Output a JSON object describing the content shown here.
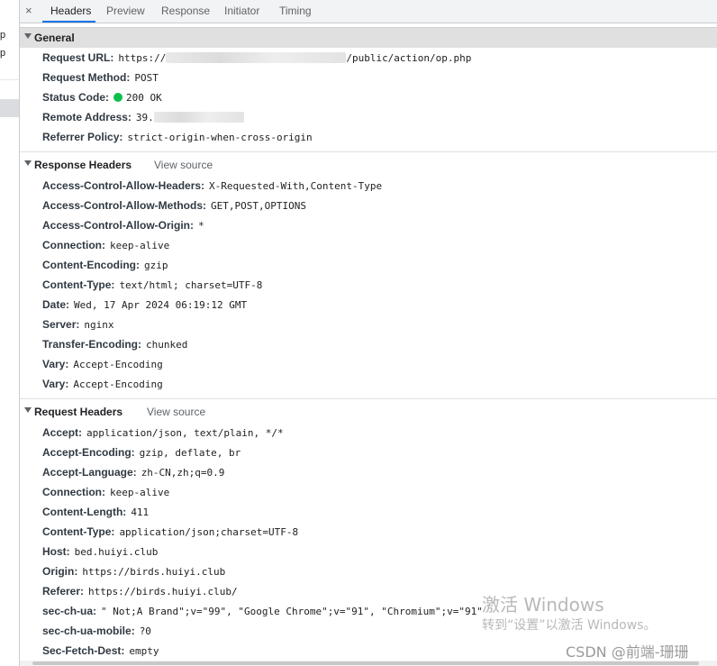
{
  "left_fragments": [
    "p",
    "p"
  ],
  "tabs": [
    {
      "label": "Headers"
    },
    {
      "label": "Preview"
    },
    {
      "label": "Response"
    },
    {
      "label": "Initiator"
    },
    {
      "label": "Timing"
    }
  ],
  "close_glyph": "×",
  "general": {
    "title": "General",
    "request_url_key": "Request URL:",
    "request_url_prefix": "https://",
    "request_url_suffix": "/public/action/op.php",
    "request_method_key": "Request Method:",
    "request_method": "POST",
    "status_code_key": "Status Code:",
    "status_code": "200 OK",
    "status_color": "#0ebe4b",
    "remote_address_key": "Remote Address:",
    "remote_address_prefix": "39.",
    "referrer_policy_key": "Referrer Policy:",
    "referrer_policy": "strict-origin-when-cross-origin"
  },
  "response_headers": {
    "title": "Response Headers",
    "view_source": "View source",
    "rows": [
      {
        "key": "Access-Control-Allow-Headers:",
        "value": "X-Requested-With,Content-Type"
      },
      {
        "key": "Access-Control-Allow-Methods:",
        "value": "GET,POST,OPTIONS"
      },
      {
        "key": "Access-Control-Allow-Origin:",
        "value": "*"
      },
      {
        "key": "Connection:",
        "value": "keep-alive"
      },
      {
        "key": "Content-Encoding:",
        "value": "gzip"
      },
      {
        "key": "Content-Type:",
        "value": "text/html; charset=UTF-8"
      },
      {
        "key": "Date:",
        "value": "Wed, 17 Apr 2024 06:19:12 GMT"
      },
      {
        "key": "Server:",
        "value": "nginx"
      },
      {
        "key": "Transfer-Encoding:",
        "value": "chunked"
      },
      {
        "key": "Vary:",
        "value": "Accept-Encoding"
      },
      {
        "key": "Vary:",
        "value": "Accept-Encoding"
      }
    ]
  },
  "request_headers": {
    "title": "Request Headers",
    "view_source": "View source",
    "rows": [
      {
        "key": "Accept:",
        "value": "application/json, text/plain, */*"
      },
      {
        "key": "Accept-Encoding:",
        "value": "gzip, deflate, br"
      },
      {
        "key": "Accept-Language:",
        "value": "zh-CN,zh;q=0.9"
      },
      {
        "key": "Connection:",
        "value": "keep-alive"
      },
      {
        "key": "Content-Length:",
        "value": "411"
      },
      {
        "key": "Content-Type:",
        "value": "application/json;charset=UTF-8"
      },
      {
        "key": "Host:",
        "value": "bed.huiyi.club"
      },
      {
        "key": "Origin:",
        "value": "https://birds.huiyi.club"
      },
      {
        "key": "Referer:",
        "value": "https://birds.huiyi.club/"
      },
      {
        "key": "sec-ch-ua:",
        "value": "\" Not;A Brand\";v=\"99\", \"Google Chrome\";v=\"91\", \"Chromium\";v=\"91\""
      },
      {
        "key": "sec-ch-ua-mobile:",
        "value": "?0"
      },
      {
        "key": "Sec-Fetch-Dest:",
        "value": "empty"
      }
    ]
  },
  "watermark": {
    "line1": "激活 Windows",
    "line2": "转到“设置”以激活 Windows。",
    "credit": "CSDN @前端-珊珊"
  }
}
